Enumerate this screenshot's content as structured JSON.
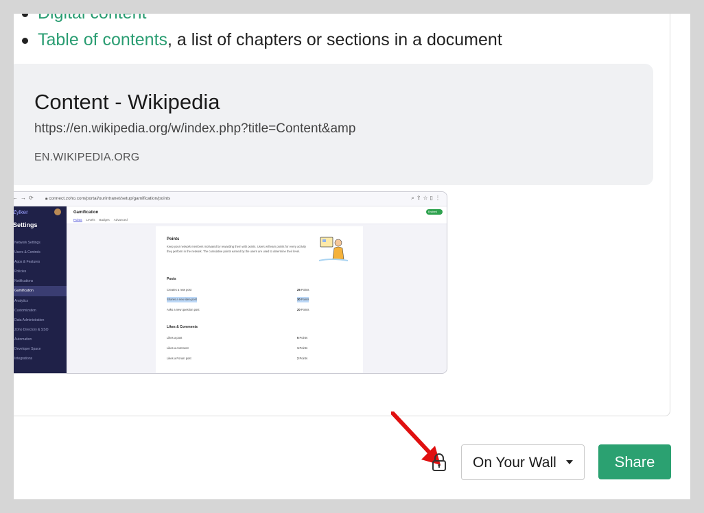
{
  "bullets": [
    {
      "link": "Digital content",
      "rest": ""
    },
    {
      "link": "Table of contents",
      "rest": ", a list of chapters or sections in a document"
    }
  ],
  "link_preview": {
    "title": "Content - Wikipedia",
    "url": "https://en.wikipedia.org/w/index.php?title=Content&amp",
    "domain": "EN.WIKIPEDIA.ORG"
  },
  "attached_screenshot": {
    "address": "connect.zoho.com/portal/ourintranet/setup/gamification/points",
    "brand": "Zylker",
    "settings_title": "Settings",
    "sidebar_items": [
      "Network Settings",
      "Users & Controls",
      "Apps & Features",
      "Policies",
      "Notifications",
      "Gamification",
      "Analytics",
      "Customization",
      "Data Administration",
      "Zoho Directory & SSO",
      "Automation",
      "Developer Space",
      "Integrations"
    ],
    "active_item": "Gamification",
    "page_title": "Gamification",
    "tabs": [
      "Points",
      "Levels",
      "Badges",
      "Advanced"
    ],
    "toggle_label": "Enabled",
    "points_title": "Points",
    "points_desc": "Keep your network members motivated by rewarding them with points. Users will earn points for every activity they perform in the network. The cumulative points earned by the users are used to determine their level.",
    "section_posts": "Posts",
    "section_likes": "Likes & Comments",
    "rows": [
      {
        "label": "Creates a new post",
        "value": "25",
        "unit": "Points"
      },
      {
        "label": "Shares a new idea post",
        "value": "30",
        "unit": "Points"
      },
      {
        "label": "Asks a new question post",
        "value": "20",
        "unit": "Points"
      },
      {
        "label": "Likes a post",
        "value": "5",
        "unit": "Points"
      },
      {
        "label": "Likes a comment",
        "value": "1",
        "unit": "Points"
      },
      {
        "label": "Likes a Forum post",
        "value": "2",
        "unit": "Points"
      }
    ]
  },
  "footer": {
    "audience_value": "On Your Wall",
    "share_label": "Share"
  },
  "colors": {
    "accent": "#2ba171",
    "link": "#2a9d72",
    "annotation_arrow": "#e01010"
  },
  "icons": {
    "privacy": "lock-icon",
    "dropdown": "caret-down-icon"
  }
}
